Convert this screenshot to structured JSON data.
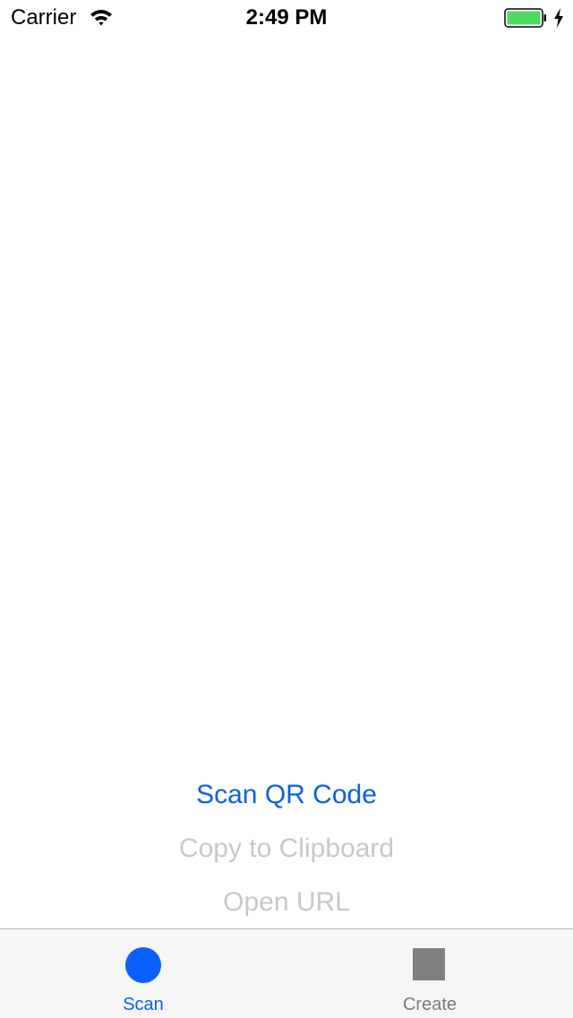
{
  "status_bar": {
    "carrier": "Carrier",
    "time": "2:49 PM",
    "wifi_icon": "wifi-icon",
    "battery_icon": "battery-icon",
    "charging_icon": "charging-bolt-icon",
    "battery_color": "#4cd964"
  },
  "actions": {
    "scan_label": "Scan QR Code",
    "copy_label": "Copy to Clipboard",
    "open_label": "Open URL",
    "active_color": "#0a60ee",
    "disabled_color": "#c8c8cc"
  },
  "tab_bar": {
    "tabs": [
      {
        "label": "Scan",
        "icon": "circle-icon",
        "selected": true
      },
      {
        "label": "Create",
        "icon": "square-icon",
        "selected": false
      }
    ],
    "selected_color": "#0a60ee",
    "unselected_color": "#7b7b7b"
  }
}
